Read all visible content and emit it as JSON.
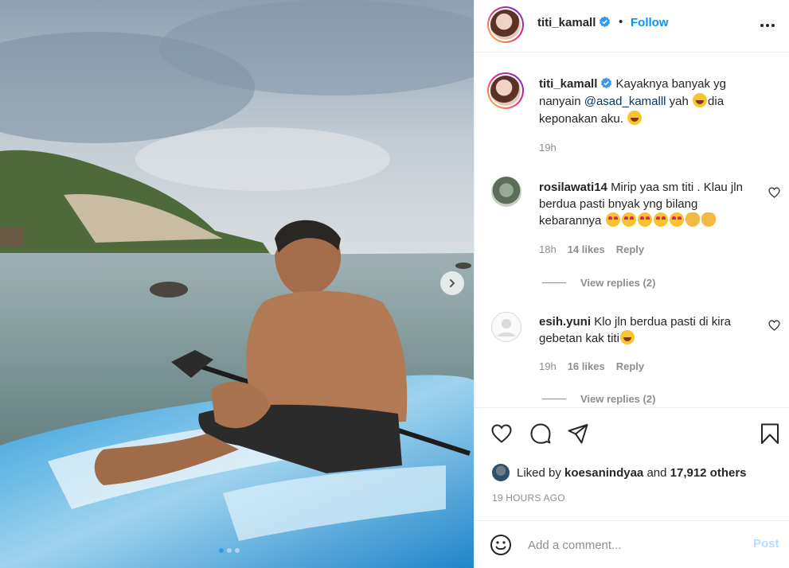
{
  "post": {
    "author": "titi_kamall",
    "verified": true,
    "follow_label": "Follow",
    "separator": "•",
    "carousel": {
      "slide_count": 3,
      "active_index": 0
    }
  },
  "caption": {
    "username": "titi_kamall",
    "text_before_mention": "Kayaknya banyak yg nanyain ",
    "mention": "@asad_kamalll",
    "text_after_mention": " yah ",
    "text_tail": "dia keponakan aku. ",
    "time": "19h"
  },
  "comments": [
    {
      "username": "rosilawati14",
      "text": "Mirip yaa sm titi . Klau jln berdua pasti bnyak yng bilang kebarannya ",
      "time": "18h",
      "likes": "14 likes",
      "reply_label": "Reply",
      "view_replies": "View replies (2)"
    },
    {
      "username": "esih.yuni",
      "text": "Klo jln berdua pasti di kira gebetan kak titi",
      "time": "19h",
      "likes": "16 likes",
      "reply_label": "Reply",
      "view_replies": "View replies (2)"
    }
  ],
  "likes": {
    "prefix": "Liked by ",
    "user": "koesanindyaa",
    "middle": " and ",
    "others": "17,912 others"
  },
  "posted_ago": "19 HOURS AGO",
  "comment_box": {
    "placeholder": "Add a comment...",
    "post_label": "Post"
  },
  "colors": {
    "accent": "#0095f6",
    "text": "#262626",
    "muted": "#8e8e8e",
    "post_disabled": "#b2dffc"
  }
}
